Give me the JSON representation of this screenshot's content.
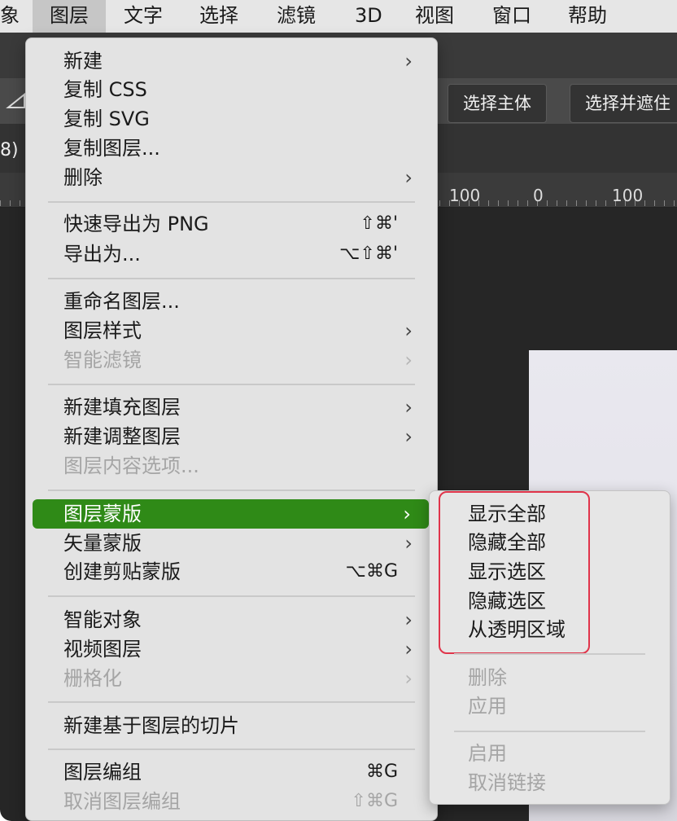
{
  "menubar": {
    "items": [
      "象",
      "图层",
      "文字",
      "选择",
      "滤镜",
      "3D",
      "视图",
      "窗口",
      "帮助"
    ],
    "active": "图层"
  },
  "optionsbar": {
    "select_subject": "选择主体",
    "select_and_mask": "选择并遮住"
  },
  "document": {
    "tab_fragment": "8)"
  },
  "ruler": {
    "labels": [
      "100",
      "0",
      "100"
    ]
  },
  "layer_menu": {
    "new": "新建",
    "copy_css": "复制 CSS",
    "copy_svg": "复制 SVG",
    "duplicate_layer": "复制图层...",
    "delete": "删除",
    "quick_export": "快速导出为 PNG",
    "quick_export_shortcut": "⇧⌘'",
    "export_as": "导出为...",
    "export_as_shortcut": "⌥⇧⌘'",
    "rename_layer": "重命名图层...",
    "layer_style": "图层样式",
    "smart_filter": "智能滤镜",
    "new_fill_layer": "新建填充图层",
    "new_adjustment_layer": "新建调整图层",
    "layer_content_options": "图层内容选项...",
    "layer_mask": "图层蒙版",
    "vector_mask": "矢量蒙版",
    "create_clipping_mask": "创建剪贴蒙版",
    "create_clipping_mask_shortcut": "⌥⌘G",
    "smart_objects": "智能对象",
    "video_layers": "视频图层",
    "rasterize": "栅格化",
    "new_layer_based_slice": "新建基于图层的切片",
    "group_layers": "图层编组",
    "group_layers_shortcut": "⌘G",
    "ungroup_layers": "取消图层编组",
    "ungroup_layers_shortcut": "⇧⌘G",
    "submenu_arrow": "›"
  },
  "layer_mask_submenu": {
    "reveal_all": "显示全部",
    "hide_all": "隐藏全部",
    "reveal_selection": "显示选区",
    "hide_selection": "隐藏选区",
    "from_transparency": "从透明区域",
    "delete": "删除",
    "apply": "应用",
    "enable": "启用",
    "unlink": "取消链接"
  },
  "colors": {
    "selected_item": "#2f8a17",
    "highlight_box": "#e0344a",
    "disabled_text": "#a5a5a5"
  }
}
